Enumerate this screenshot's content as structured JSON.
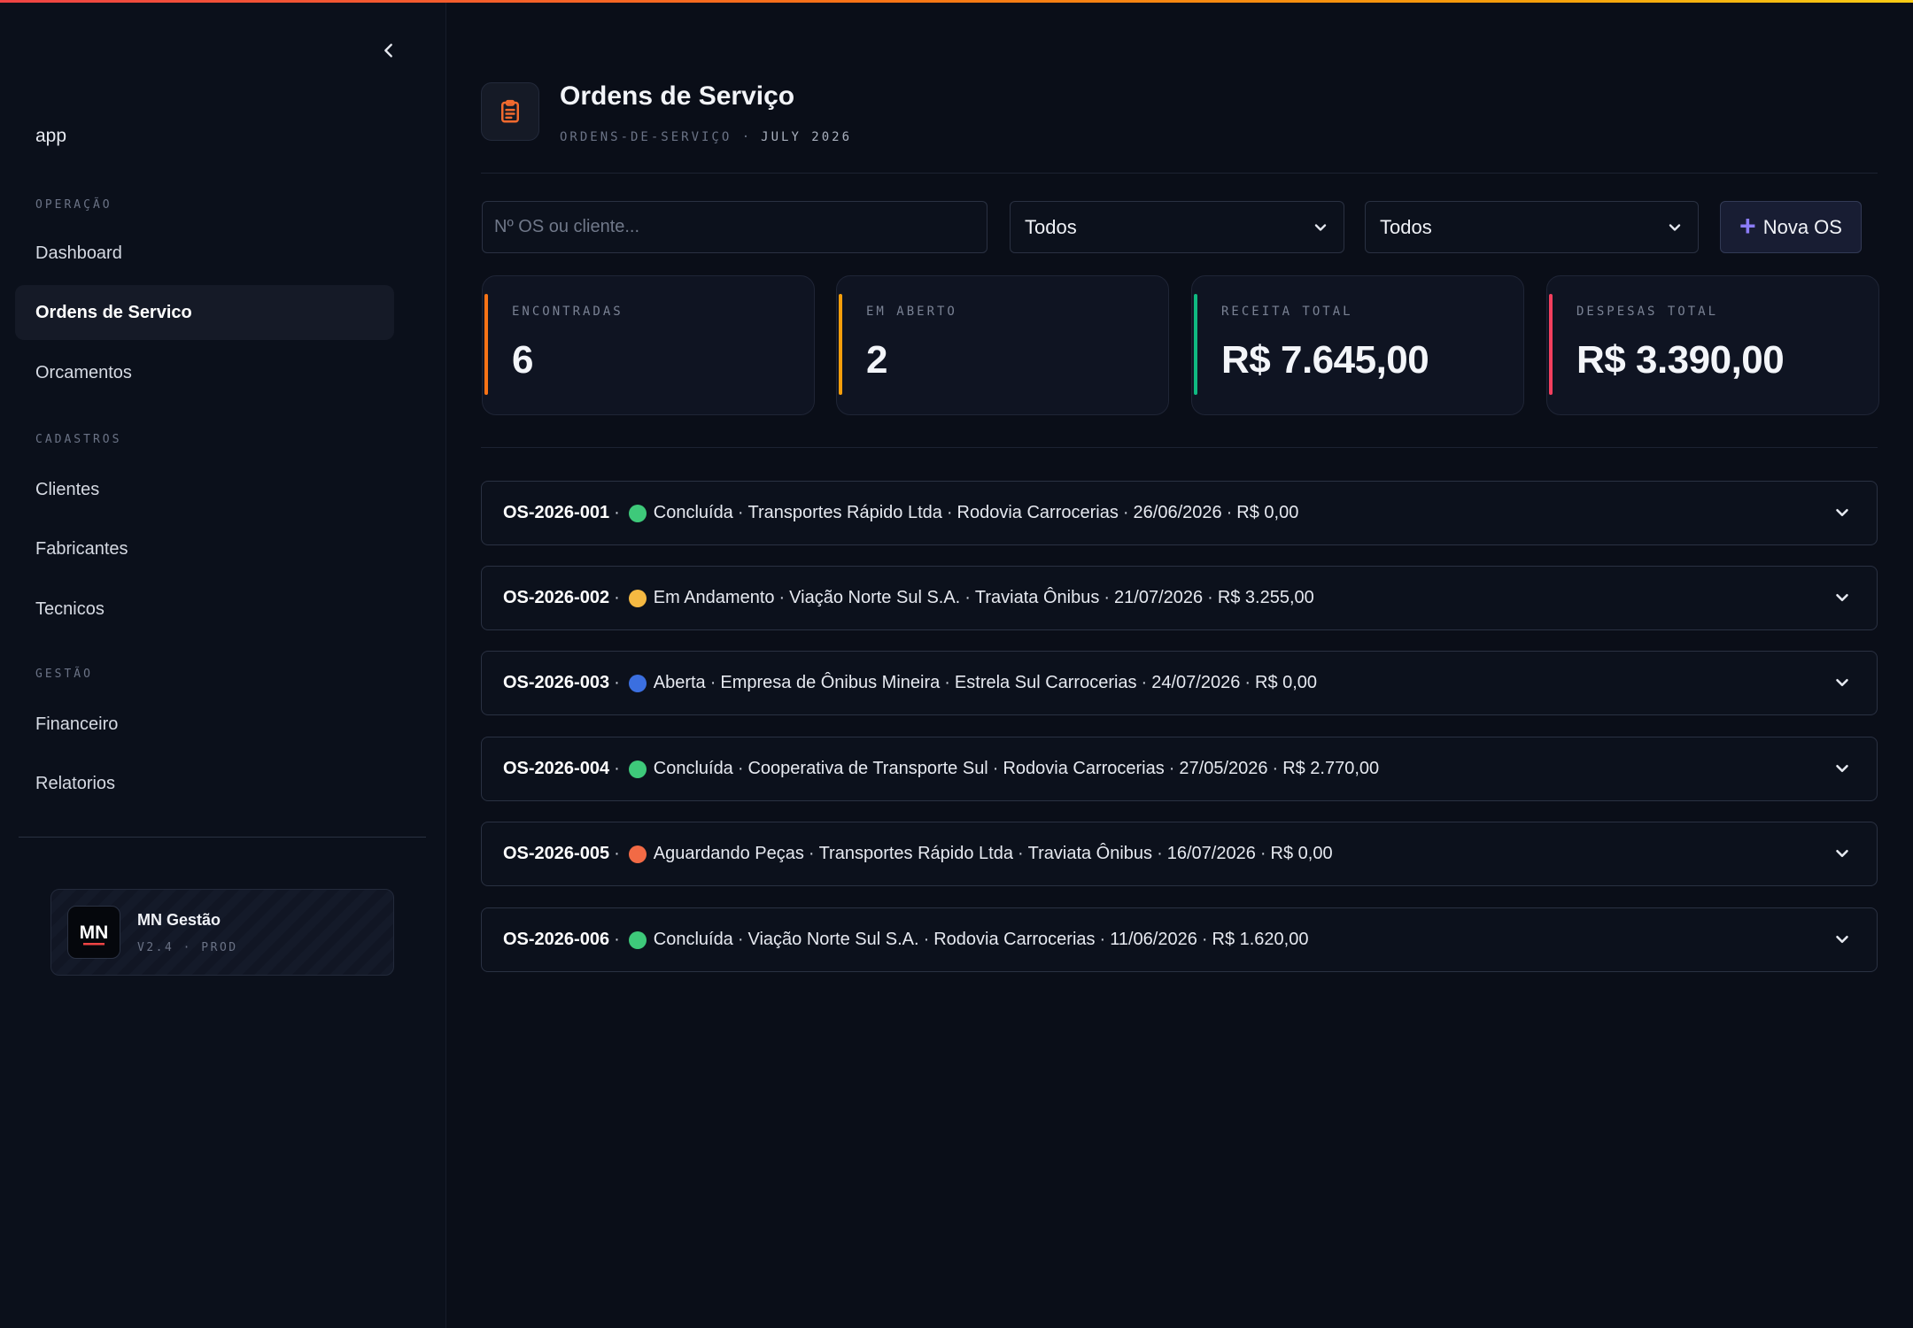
{
  "sidebar": {
    "app_label": "app",
    "sections": [
      {
        "label": "OPERAÇÃO",
        "items": [
          "Dashboard",
          "Ordens de Servico",
          "Orcamentos"
        ]
      },
      {
        "label": "CADASTROS",
        "items": [
          "Clientes",
          "Fabricantes",
          "Tecnicos"
        ]
      },
      {
        "label": "GESTÃO",
        "items": [
          "Financeiro",
          "Relatorios"
        ]
      }
    ],
    "active_item": "Ordens de Servico",
    "brand": {
      "name": "MN Gestão",
      "version": "V2.4 · PROD",
      "logo_text": "MN"
    }
  },
  "header": {
    "title": "Ordens de Serviço",
    "breadcrumb": "ORDENS-DE-SERVIÇO ·",
    "month": "JULY 2026"
  },
  "filters": {
    "search_placeholder": "Nº OS ou cliente...",
    "status_select": "Todos",
    "second_select": "Todos",
    "new_button": "Nova OS"
  },
  "stats": [
    {
      "label": "ENCONTRADAS",
      "value": "6",
      "accent": "#f97316"
    },
    {
      "label": "EM ABERTO",
      "value": "2",
      "accent": "#f59e0b"
    },
    {
      "label": "RECEITA TOTAL",
      "value": "R$ 7.645,00",
      "accent": "#10b981"
    },
    {
      "label": "DESPESAS TOTAL",
      "value": "R$ 3.390,00",
      "accent": "#f43f5e"
    }
  ],
  "status_colors": {
    "Concluída": "#3ec97a",
    "Em Andamento": "#f5b942",
    "Aberta": "#3b6fe0",
    "Aguardando Peças": "#f26a45"
  },
  "orders": [
    {
      "id": "OS-2026-001",
      "status": "Concluída",
      "client": "Transportes Rápido Ltda",
      "manufacturer": "Rodovia Carrocerias",
      "date": "26/06/2026",
      "value": "R$ 0,00"
    },
    {
      "id": "OS-2026-002",
      "status": "Em Andamento",
      "client": "Viação Norte Sul S.A.",
      "manufacturer": "Traviata Ônibus",
      "date": "21/07/2026",
      "value": "R$ 3.255,00"
    },
    {
      "id": "OS-2026-003",
      "status": "Aberta",
      "client": "Empresa de Ônibus Mineira",
      "manufacturer": "Estrela Sul Carrocerias",
      "date": "24/07/2026",
      "value": "R$ 0,00"
    },
    {
      "id": "OS-2026-004",
      "status": "Concluída",
      "client": "Cooperativa de Transporte Sul",
      "manufacturer": "Rodovia Carrocerias",
      "date": "27/05/2026",
      "value": "R$ 2.770,00"
    },
    {
      "id": "OS-2026-005",
      "status": "Aguardando Peças",
      "client": "Transportes Rápido Ltda",
      "manufacturer": "Traviata Ônibus",
      "date": "16/07/2026",
      "value": "R$ 0,00"
    },
    {
      "id": "OS-2026-006",
      "status": "Concluída",
      "client": "Viação Norte Sul S.A.",
      "manufacturer": "Rodovia Carrocerias",
      "date": "11/06/2026",
      "value": "R$ 1.620,00"
    }
  ]
}
